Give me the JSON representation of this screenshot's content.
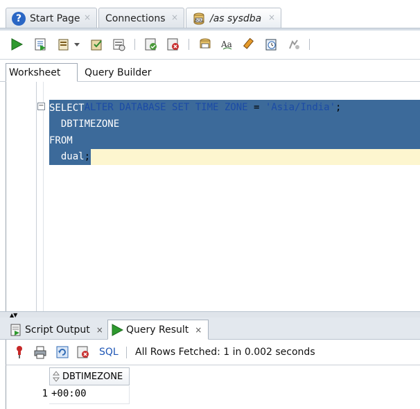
{
  "doc_tabs": [
    {
      "label": "Start Page",
      "icon": "help-circle-icon"
    },
    {
      "label": "Connections",
      "icon": ""
    },
    {
      "label": "/as sysdba",
      "icon": "sql-database-icon"
    }
  ],
  "sub_tabs": {
    "worksheet": "Worksheet",
    "query_builder": "Query Builder"
  },
  "editor": {
    "lines": [
      {
        "kw1": "ALTER DATABASE SET TIME ZONE",
        "op": " = ",
        "str": "'Asia/India'",
        "end": ";"
      },
      {
        "text": "SELECT"
      },
      {
        "text": "  DBTIMEZONE"
      },
      {
        "text": "FROM"
      },
      {
        "text": "  dual",
        "end": ";"
      }
    ]
  },
  "output_tabs": [
    {
      "label": "Script Output",
      "close": "×"
    },
    {
      "label": "Query Result",
      "close": "×"
    }
  ],
  "result_toolbar": {
    "sql_label": "SQL",
    "status": "All Rows Fetched: 1 in 0.002 seconds"
  },
  "grid": {
    "columns": [
      "DBTIMEZONE"
    ],
    "rows": [
      {
        "num": "1",
        "values": [
          "+00:00"
        ]
      }
    ]
  },
  "colors": {
    "selection": "#3c6a9a",
    "current_line": "#fdf6cf",
    "keyword": "#1b4ba6",
    "run_green": "#2e9a2e"
  }
}
